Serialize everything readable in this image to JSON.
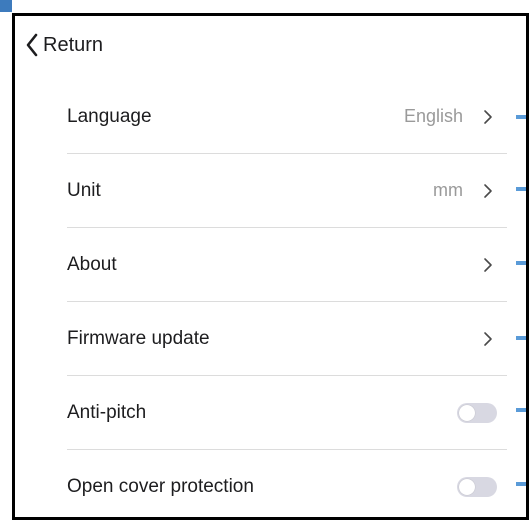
{
  "header": {
    "return_label": "Return"
  },
  "settings": {
    "items": [
      {
        "label": "Language",
        "value": "English",
        "control": "chevron"
      },
      {
        "label": "Unit",
        "value": "mm",
        "control": "chevron"
      },
      {
        "label": "About",
        "value": "",
        "control": "chevron"
      },
      {
        "label": "Firmware update",
        "value": "",
        "control": "chevron"
      },
      {
        "label": "Anti-pitch",
        "value": "",
        "control": "toggle",
        "toggle_on": false
      },
      {
        "label": "Open cover protection",
        "value": "",
        "control": "toggle",
        "toggle_on": false
      }
    ]
  },
  "colors": {
    "accent": "#5a9bd8",
    "toggle_off": "#d8d8e2",
    "value_text": "#9a9a9a"
  }
}
